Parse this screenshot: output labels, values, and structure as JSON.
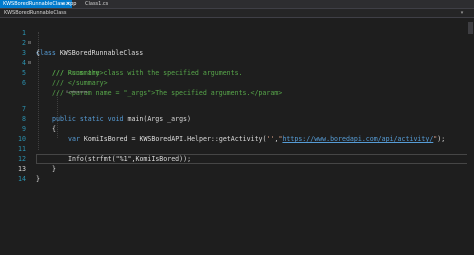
{
  "tabs": [
    {
      "label": "KWSBoredRunnableClass.xpp",
      "active": true
    },
    {
      "label": "Class1.cs",
      "active": false
    }
  ],
  "nav": {
    "combo_label": "KWSBoredRunnableClass"
  },
  "codelens": "0 references",
  "lines": [
    {
      "n": "1",
      "text": ""
    },
    {
      "n": "2",
      "text": "{"
    },
    {
      "n": "3",
      "text": "/// <summary>"
    },
    {
      "n": "4",
      "text": "/// Runs the class with the specified arguments."
    },
    {
      "n": "5",
      "text": "/// </summary>"
    },
    {
      "n": "6",
      "text": "/// <param name = \"_args\">The specified arguments.</param>"
    },
    {
      "n": "7",
      "text": ""
    },
    {
      "n": "8",
      "text": "{"
    },
    {
      "n": "9",
      "text": ""
    },
    {
      "n": "10",
      "text": ""
    },
    {
      "n": "11",
      "text": "Info(strfmt(\"%1\",KomiIsBored));"
    },
    {
      "n": "12",
      "text": "}"
    },
    {
      "n": "13",
      "text": "}"
    },
    {
      "n": "14",
      "text": ""
    }
  ],
  "l1": {
    "kw": "class",
    "name": " KWSBoredRunnableClass"
  },
  "l7": {
    "kw1": "public",
    "kw2": "static",
    "kw3": "void",
    "rest": " main(Args _args)"
  },
  "l9": {
    "kw": "var",
    "rest1": " KomiIsBored = KWSBoredAPI.Helper::getActivity(",
    "str1": "''",
    "comma": ",",
    "str2": "\"",
    "url": "https://www.boredapi.com/api/activity/",
    "str3": "\"",
    "rest2": ");"
  },
  "colors": {
    "background": "#1e1e1e",
    "keyword": "#569cd6",
    "comment": "#57a64a",
    "string": "#d69d85",
    "line_number": "#2b91af",
    "tab_active": "#007acc"
  }
}
